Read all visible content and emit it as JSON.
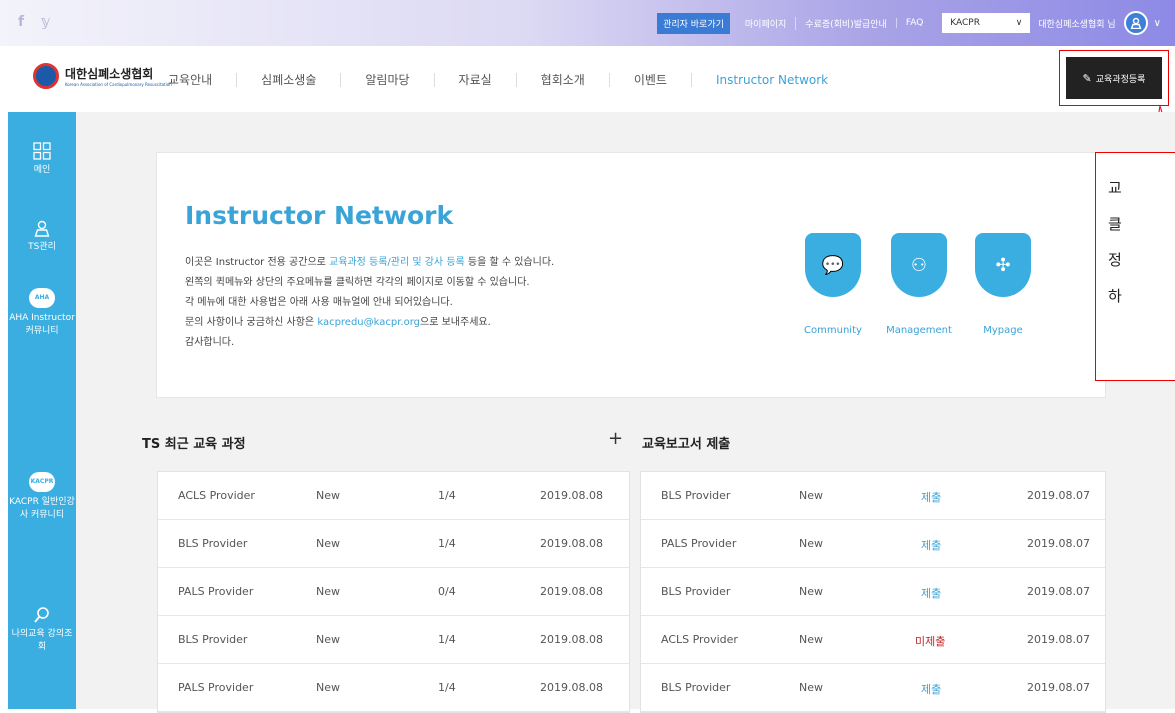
{
  "topbar": {
    "social": "f 𝕪",
    "admin_link": "관리자 바로가기",
    "links": [
      "마이페이지",
      "수료증(회비)발급안내",
      "FAQ"
    ],
    "org_select": "KACPR",
    "user_name": "대한심폐소생협회 님"
  },
  "header": {
    "logo_main": "대한심폐소생협회",
    "logo_sub": "Korean Association of Cardiopulmonary Resuscitation",
    "nav": [
      "교육안내",
      "심폐소생술",
      "알림마당",
      "자료실",
      "협회소개",
      "이벤트",
      "Instructor Network"
    ],
    "register_button": "교육과정등록"
  },
  "sidebar": {
    "items": [
      {
        "label": "메인",
        "icon": "grid-icon"
      },
      {
        "label": "TS관리",
        "icon": "user-icon"
      },
      {
        "label": "AHA Instructor 커뮤니티",
        "badge": "AHA"
      },
      {
        "label": "KACPR 일반인강사 커뮤니티",
        "badge": "KACPR"
      },
      {
        "label": "나의교육 강의조회",
        "icon": "search-icon"
      }
    ]
  },
  "hero": {
    "title": "Instructor Network",
    "line1_pre": "이곳은 Instructor 전용 공간으로 ",
    "line1_hl": "교육과정 등록/관리 및 강사 등록",
    "line1_post": " 등을 할 수 있습니다.",
    "line2": "왼쪽의 퀵메뉴와 상단의 주요메뉴를 클릭하면 각각의 페이지로 이동할 수 있습니다.",
    "line3": "각 메뉴에 대한 사용법은 아래 사용 매뉴얼에 안내 되어있습니다.",
    "line4_pre": "문의 사항이나 궁금하신 사항은 ",
    "line4_hl": "kacpredu@kacpr.org",
    "line4_post": "으로 보내주세요.",
    "line5": "감사합니다.",
    "shields": [
      "Community",
      "Management",
      "Mypage"
    ]
  },
  "recent": {
    "title": "TS 최근 교육 과정",
    "rows": [
      {
        "course": "ACLS Provider",
        "status": "New",
        "count": "1/4",
        "date": "2019.08.08"
      },
      {
        "course": "BLS Provider",
        "status": "New",
        "count": "1/4",
        "date": "2019.08.08"
      },
      {
        "course": "PALS Provider",
        "status": "New",
        "count": "0/4",
        "date": "2019.08.08"
      },
      {
        "course": "BLS Provider",
        "status": "New",
        "count": "1/4",
        "date": "2019.08.08"
      },
      {
        "course": "PALS Provider",
        "status": "New",
        "count": "1/4",
        "date": "2019.08.08"
      }
    ]
  },
  "reports": {
    "title": "교육보고서 제출",
    "rows": [
      {
        "course": "BLS Provider",
        "status": "New",
        "submit": "제출",
        "date": "2019.08.07"
      },
      {
        "course": "PALS Provider",
        "status": "New",
        "submit": "제출",
        "date": "2019.08.07"
      },
      {
        "course": "BLS Provider",
        "status": "New",
        "submit": "제출",
        "date": "2019.08.07"
      },
      {
        "course": "ACLS Provider",
        "status": "New",
        "submit": "미제출",
        "date": "2019.08.07"
      },
      {
        "course": "BLS Provider",
        "status": "New",
        "submit": "제출",
        "date": "2019.08.07"
      }
    ]
  },
  "callout": {
    "lines": [
      "교",
      "클",
      "정",
      "하"
    ]
  },
  "colors": {
    "accent": "#3aaee0",
    "danger": "#c02424",
    "dark": "#222222"
  }
}
